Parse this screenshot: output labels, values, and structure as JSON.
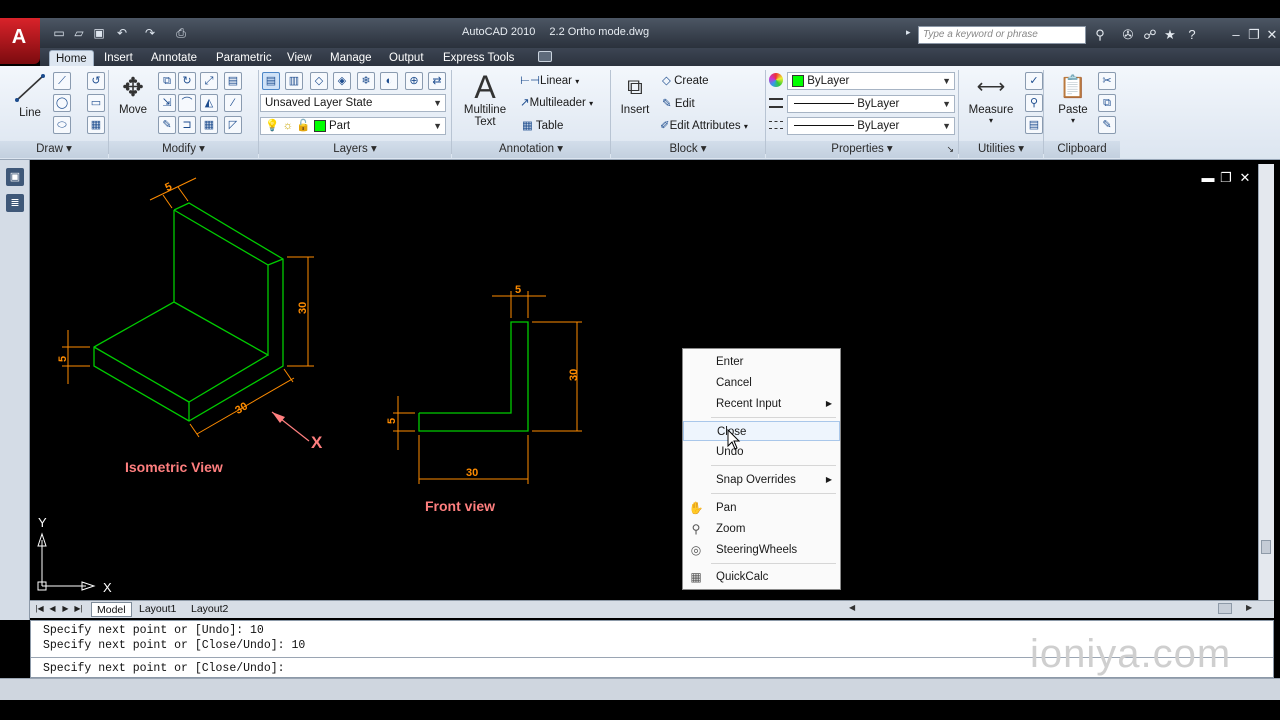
{
  "window": {
    "app_name": "AutoCAD 2010",
    "file_name": "2.2 Ortho mode.dwg",
    "search_placeholder": "Type a keyword or phrase"
  },
  "ribbon_tabs": [
    "Home",
    "Insert",
    "Annotate",
    "Parametric",
    "View",
    "Manage",
    "Output",
    "Express Tools"
  ],
  "active_tab": "Home",
  "ribbon": {
    "draw": {
      "title": "Draw",
      "line_label": "Line"
    },
    "modify": {
      "title": "Modify",
      "move_label": "Move"
    },
    "layers": {
      "title": "Layers",
      "layer_state": "Unsaved Layer State",
      "current_layer": "Part",
      "layer_color": "#00ff00"
    },
    "annotation": {
      "title": "Annotation",
      "multiline_text": "Multiline",
      "multiline_text2": "Text",
      "linear": "Linear",
      "multileader": "Multileader",
      "table": "Table"
    },
    "block": {
      "title": "Block",
      "insert": "Insert",
      "create": "Create",
      "edit": "Edit",
      "edit_attributes": "Edit Attributes"
    },
    "properties": {
      "title": "Properties",
      "color": "ByLayer",
      "linetype": "ByLayer",
      "lineweight": "ByLayer"
    },
    "utilities": {
      "title": "Utilities",
      "measure": "Measure"
    },
    "clipboard": {
      "title": "Clipboard",
      "paste": "Paste"
    }
  },
  "drawing": {
    "isometric_label": "Isometric View",
    "front_label": "Front view",
    "iso_dims": {
      "top_width": "5",
      "height": "30",
      "thickness": "5",
      "length": "30"
    },
    "front_dims": {
      "top_width": "5",
      "height": "30",
      "thickness": "5",
      "length": "30"
    },
    "x_marker": "X",
    "ucs_x": "X",
    "ucs_y": "Y",
    "colors": {
      "geometry": "#00cc00",
      "dimension": "#ff8c00",
      "label": "#ff7f7f",
      "background": "#000000"
    }
  },
  "layout_tabs": [
    "Model",
    "Layout1",
    "Layout2"
  ],
  "active_layout": "Model",
  "context_menu": {
    "items": [
      {
        "label": "Enter"
      },
      {
        "label": "Cancel"
      },
      {
        "label": "Recent Input",
        "submenu": true
      },
      {
        "label": "Close",
        "highlighted": true
      },
      {
        "label": "Undo"
      },
      {
        "label": "Snap Overrides",
        "submenu": true
      },
      {
        "label": "Pan",
        "icon": "pan-hand-icon"
      },
      {
        "label": "Zoom",
        "icon": "zoom-magnifier-icon"
      },
      {
        "label": "SteeringWheels",
        "icon": "steering-wheel-icon"
      },
      {
        "label": "QuickCalc",
        "icon": "calculator-icon"
      }
    ]
  },
  "command_history": [
    "Specify next point or [Undo]: 10",
    "Specify next point or [Close/Undo]: 10",
    "Specify next point or [Close/Undo]:"
  ],
  "watermark": "ioniya.com"
}
